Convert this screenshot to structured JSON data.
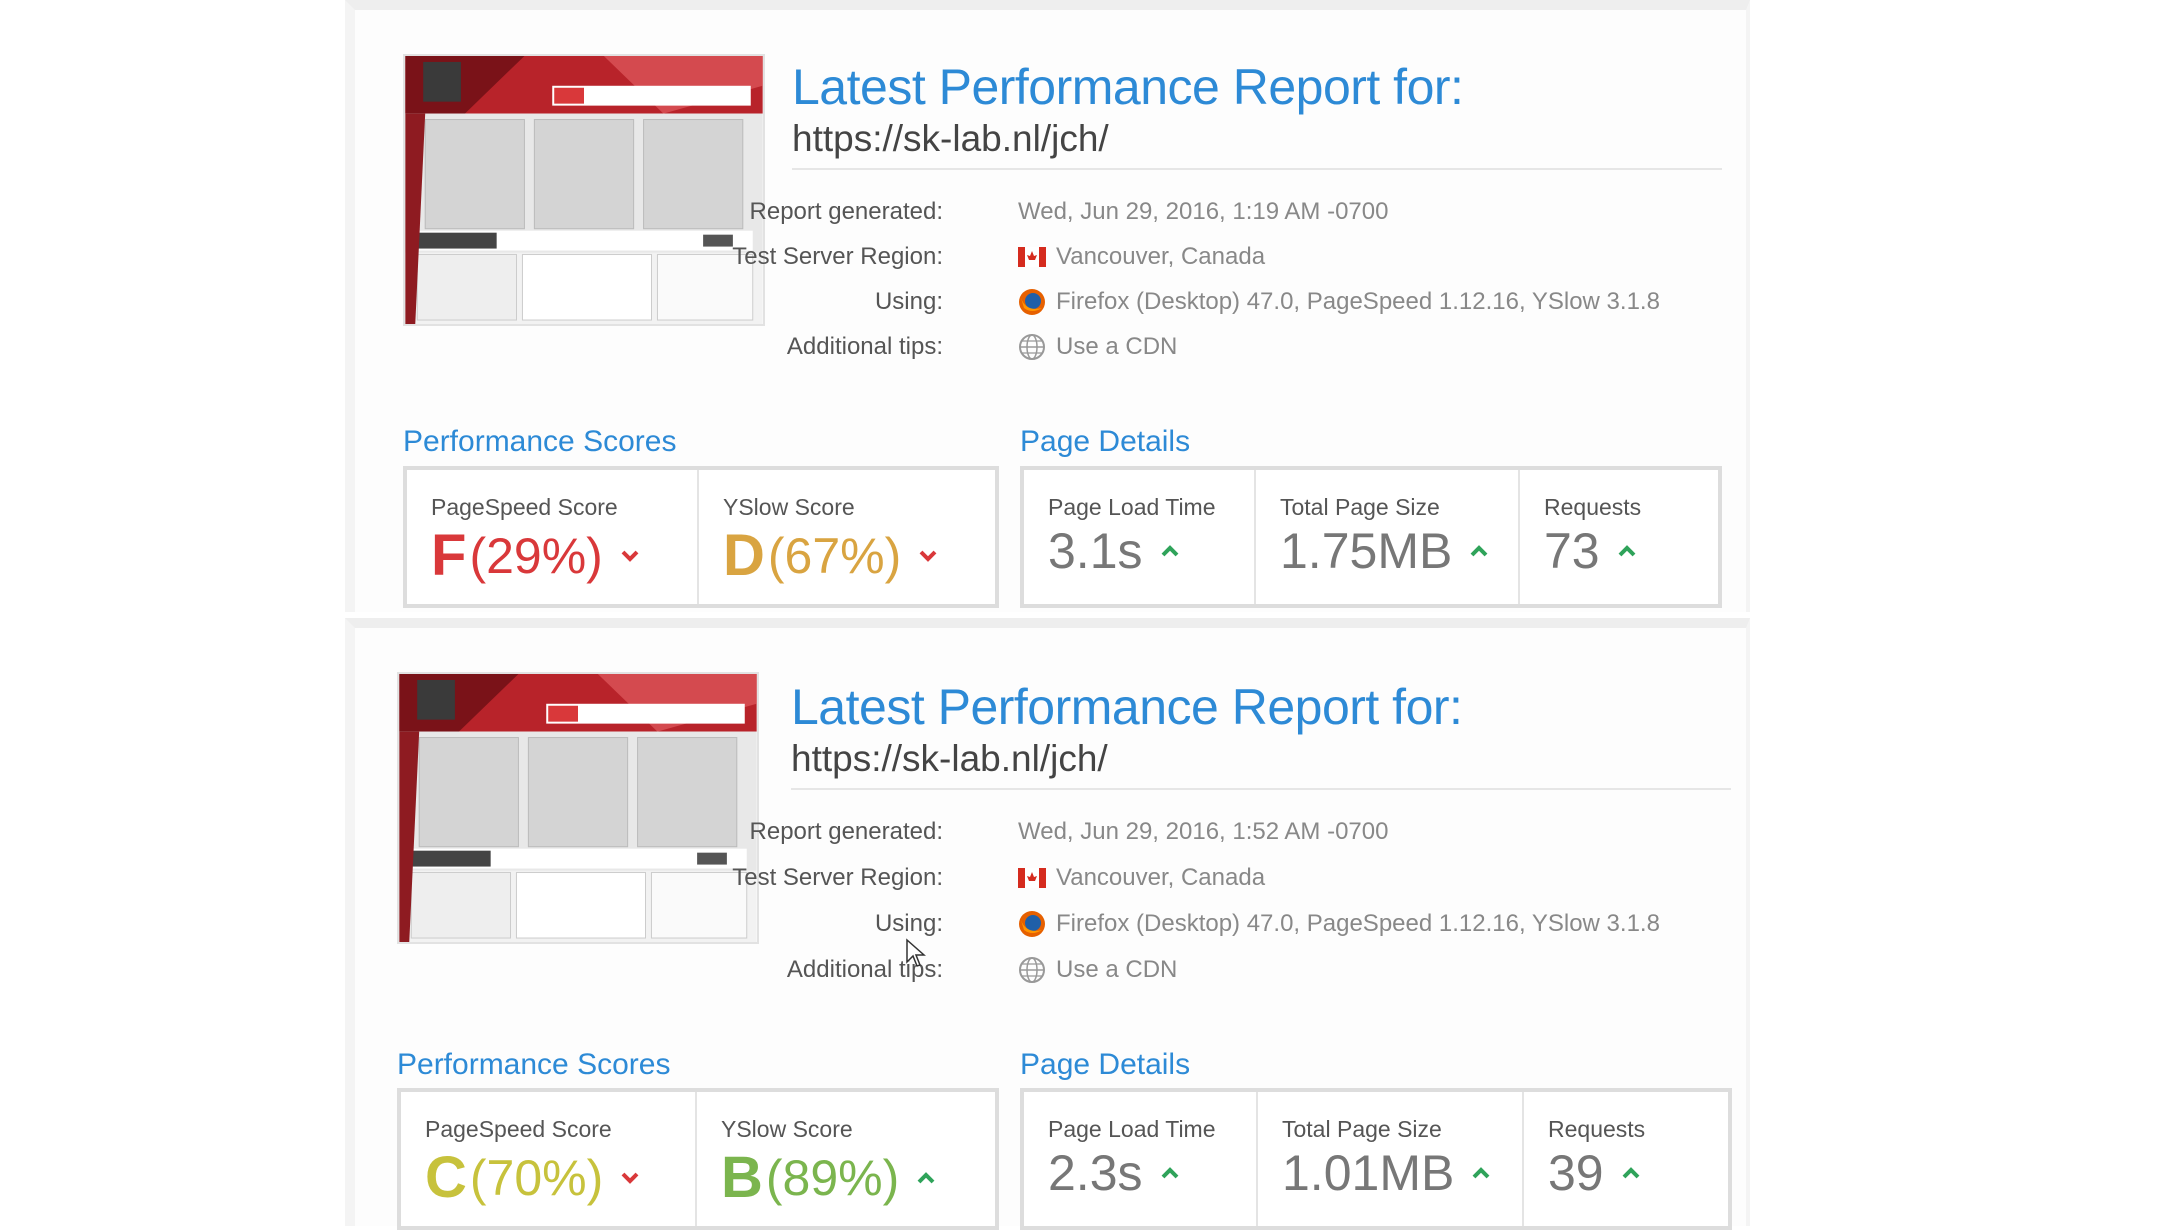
{
  "colors": {
    "title_blue": "#2d8ad6",
    "grade_F": "#d9383a",
    "grade_D": "#d9a441",
    "grade_C": "#c7c23c",
    "grade_B": "#7bb54e",
    "arrow_up": "#2fa35a",
    "arrow_down": "#d9383a"
  },
  "reports": [
    {
      "title": "Latest Performance Report for:",
      "url": "https://sk-lab.nl/jch/",
      "report_generated_label": "Report generated:",
      "report_generated_value": "Wed, Jun 29, 2016, 1:19 AM -0700",
      "region_label": "Test Server Region:",
      "region_value": "Vancouver, Canada",
      "region_icon": "canada-flag-icon",
      "using_label": "Using:",
      "using_value": "Firefox (Desktop) 47.0, PageSpeed 1.12.16, YSlow 3.1.8",
      "using_icon": "firefox-icon",
      "tips_label": "Additional tips:",
      "tips_value": "Use a CDN",
      "tips_icon": "globe-icon",
      "performance_title": "Performance Scores",
      "pagespeed_label": "PageSpeed Score",
      "pagespeed_grade": "F",
      "pagespeed_pct": "(29%)",
      "pagespeed_trend": "down",
      "yslow_label": "YSlow Score",
      "yslow_grade": "D",
      "yslow_pct": "(67%)",
      "yslow_trend": "down",
      "details_title": "Page Details",
      "load_label": "Page Load Time",
      "load_value": "3.1s",
      "size_label": "Total Page Size",
      "size_value": "1.75MB",
      "requests_label": "Requests",
      "requests_value": "73"
    },
    {
      "title": "Latest Performance Report for:",
      "url": "https://sk-lab.nl/jch/",
      "report_generated_label": "Report generated:",
      "report_generated_value": "Wed, Jun 29, 2016, 1:52 AM -0700",
      "region_label": "Test Server Region:",
      "region_value": "Vancouver, Canada",
      "region_icon": "canada-flag-icon",
      "using_label": "Using:",
      "using_value": "Firefox (Desktop) 47.0, PageSpeed 1.12.16, YSlow 3.1.8",
      "using_icon": "firefox-icon",
      "tips_label": "Additional tips:",
      "tips_value": "Use a CDN",
      "tips_icon": "globe-icon",
      "performance_title": "Performance Scores",
      "pagespeed_label": "PageSpeed Score",
      "pagespeed_grade": "C",
      "pagespeed_pct": "(70%)",
      "pagespeed_trend": "down",
      "yslow_label": "YSlow Score",
      "yslow_grade": "B",
      "yslow_pct": "(89%)",
      "yslow_trend": "up",
      "details_title": "Page Details",
      "load_label": "Page Load Time",
      "load_value": "2.3s",
      "size_label": "Total Page Size",
      "size_value": "1.01MB",
      "requests_label": "Requests",
      "requests_value": "39"
    }
  ]
}
